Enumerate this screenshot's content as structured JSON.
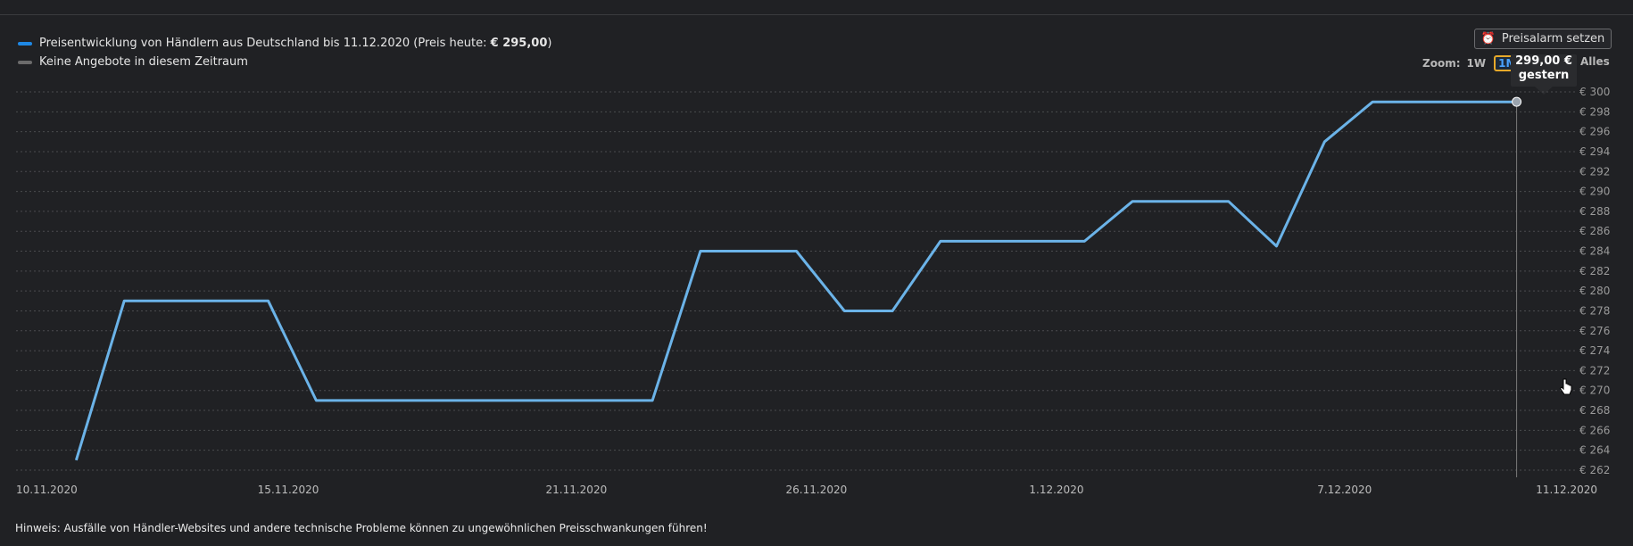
{
  "legend": {
    "series_text_prefix": "Preisentwicklung von Händlern aus Deutschland bis 11.12.2020 (Preis heute: ",
    "series_text_price": "€ 295,00",
    "series_text_suffix": ")",
    "no_offers_text": "Keine Angebote in diesem Zeitraum"
  },
  "alarm_button": {
    "label": "Preisalarm setzen",
    "icon": "alarm-clock-icon"
  },
  "zoom": {
    "label": "Zoom:",
    "options": [
      "1W",
      "1M"
    ],
    "active": "1M",
    "all_label": "Alles"
  },
  "tooltip": {
    "value": "299,00 €",
    "date": "gestern"
  },
  "note": "Hinweis: Ausfälle von Händler-Websites und andere technische Probleme können zu ungewöhnlichen Preisschwankungen führen!",
  "colors": {
    "line": "#6bb3e8",
    "accent": "#1e88e5",
    "background": "#202124",
    "grid": "#4a4b4e"
  },
  "chart_data": {
    "type": "line",
    "ylim": [
      262,
      300
    ],
    "y_ticks": [
      262,
      264,
      266,
      268,
      270,
      272,
      274,
      276,
      278,
      280,
      282,
      284,
      286,
      288,
      290,
      292,
      294,
      296,
      298,
      300
    ],
    "y_tick_prefix": "€ ",
    "x_range": [
      "2020-11-10",
      "2020-12-11"
    ],
    "x_ticks": [
      {
        "date": "2020-11-10",
        "label": "10.11.2020"
      },
      {
        "date": "2020-11-15",
        "label": "15.11.2020"
      },
      {
        "date": "2020-11-21",
        "label": "21.11.2020"
      },
      {
        "date": "2020-11-26",
        "label": "26.11.2020"
      },
      {
        "date": "2020-12-01",
        "label": "1.12.2020"
      },
      {
        "date": "2020-12-07",
        "label": "7.12.2020"
      },
      {
        "date": "2020-12-11",
        "label": "11.12.2020"
      }
    ],
    "grid": true,
    "series": [
      {
        "values": [
          [
            "2020-11-10T14:00",
            263
          ],
          [
            "2020-11-11T14:00",
            279
          ],
          [
            "2020-11-14T14:00",
            279
          ],
          [
            "2020-11-15T14:00",
            269
          ],
          [
            "2020-11-22T14:00",
            269
          ],
          [
            "2020-11-23T14:00",
            284
          ],
          [
            "2020-11-25T14:00",
            284
          ],
          [
            "2020-11-26T14:00",
            278
          ],
          [
            "2020-11-27T14:00",
            278
          ],
          [
            "2020-11-28T14:00",
            285
          ],
          [
            "2020-12-01T14:00",
            285
          ],
          [
            "2020-12-02T14:00",
            289
          ],
          [
            "2020-12-04T14:00",
            289
          ],
          [
            "2020-12-05T14:00",
            284.5
          ],
          [
            "2020-12-06T14:00",
            295
          ],
          [
            "2020-12-07T14:00",
            299
          ],
          [
            "2020-12-10T14:00",
            299
          ]
        ]
      }
    ],
    "highlight": {
      "date": "2020-12-10T14:00",
      "value": 299
    }
  }
}
